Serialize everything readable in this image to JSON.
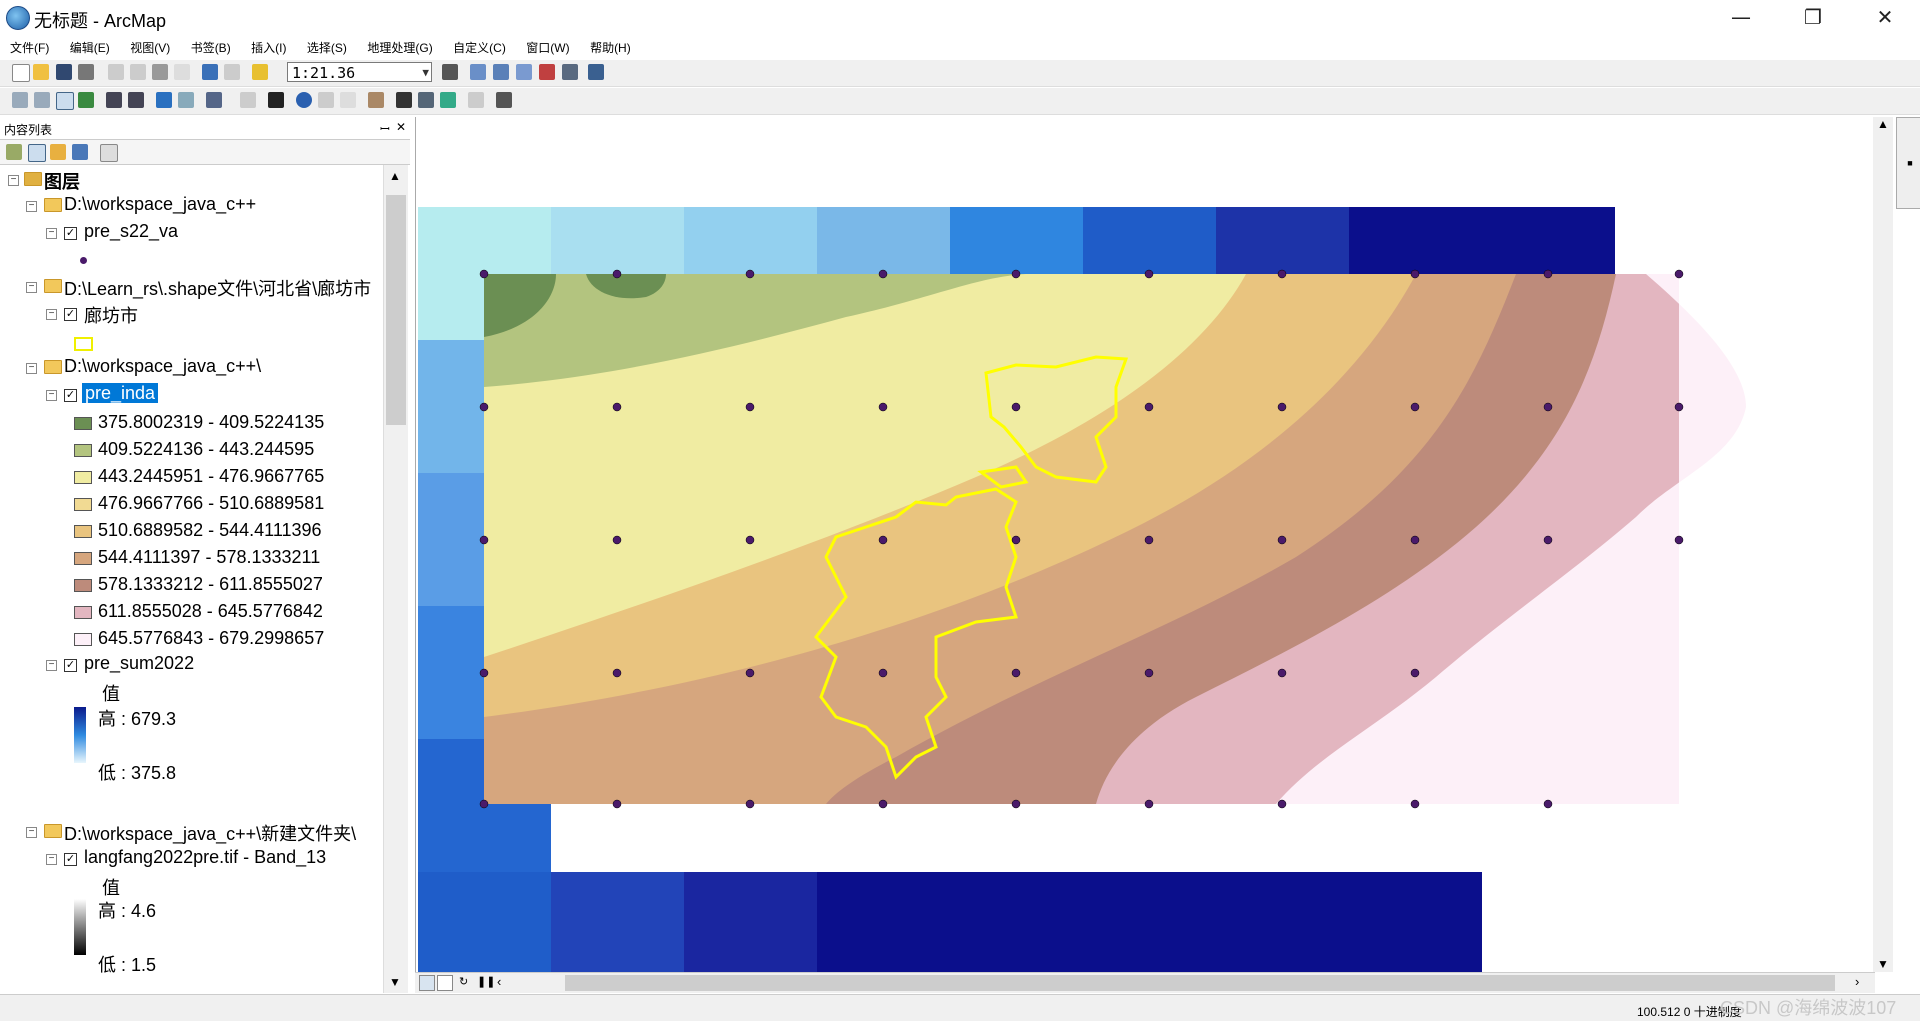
{
  "window": {
    "title": "无标题 - ArcMap",
    "minimize": "—",
    "restore": "❐",
    "close": "✕"
  },
  "menu": [
    "文件(F)",
    "编辑(E)",
    "视图(V)",
    "书签(B)",
    "插入(I)",
    "选择(S)",
    "地理处理(G)",
    "自定义(C)",
    "窗口(W)",
    "帮助(H)"
  ],
  "toolbar": {
    "scale": "1:21.36"
  },
  "toc": {
    "title": "内容列表",
    "pin": "ꟷ",
    "close": "✕",
    "root": "图层",
    "groups": [
      {
        "path": "D:\\workspace_java_c++",
        "layer": "pre_s22_va"
      },
      {
        "path": "D:\\Learn_rs\\.shape文件\\河北省\\廊坊市",
        "layer": "廊坊市"
      },
      {
        "path": "D:\\workspace_java_c++\\",
        "layer": "pre_inda",
        "classes": [
          {
            "label": "375.8002319 - 409.5224135",
            "color": "#6b8f53"
          },
          {
            "label": "409.5224136 - 443.244595",
            "color": "#b3c47f"
          },
          {
            "label": "443.2445951 - 476.9667765",
            "color": "#f0eca2"
          },
          {
            "label": "476.9667766 - 510.6889581",
            "color": "#f1da93"
          },
          {
            "label": "510.6889582 - 544.4111396",
            "color": "#e9c47f"
          },
          {
            "label": "544.4111397 - 578.1333211",
            "color": "#d6a67e"
          },
          {
            "label": "578.1333212 - 611.8555027",
            "color": "#bd8b7b"
          },
          {
            "label": "611.8555028 - 645.5776842",
            "color": "#e3b6c0"
          },
          {
            "label": "645.5776843 - 679.2998657",
            "color": "#fdf0f8"
          }
        ]
      },
      {
        "layer": "pre_sum2022",
        "field": "值",
        "high": "高 : 679.3",
        "low": "低 : 375.8"
      },
      {
        "path": "D:\\workspace_java_c++\\新建文件夹\\",
        "layer": "langfang2022pre.tif - Band_13",
        "field": "值",
        "high": "高 : 4.6",
        "low": "低 : 1.5"
      }
    ]
  },
  "map": {
    "blue_grid": [
      [
        "#b6ecef",
        "#a9dff0",
        "#93d0ef",
        "#7ab8e8",
        "#2f86e0",
        "#1f5cc8",
        "#1d33a8",
        "#0b0f8c",
        "#0b0f8c"
      ],
      [
        "#72b5ea",
        null,
        null,
        null,
        null,
        null,
        null,
        null,
        "#0b0f8c"
      ],
      [
        "#5a9de6",
        null,
        null,
        null,
        null,
        null,
        null,
        null,
        "#0b0f8c"
      ],
      [
        "#3a84e0",
        null,
        null,
        null,
        null,
        null,
        null,
        null,
        null
      ],
      [
        "#2466d0",
        null,
        null,
        null,
        null,
        null,
        null,
        null,
        null
      ],
      [
        "#1f5dc9",
        "#2244b8",
        "#1a26a0",
        "#0b0f8c",
        "#0b0f8c",
        "#0b0f8c",
        "#0b0f8c",
        "#0b0f8c",
        null
      ]
    ]
  },
  "status": {
    "coords": "100.512  0 十进制度"
  },
  "watermark": "CSDN @海绵波波107"
}
